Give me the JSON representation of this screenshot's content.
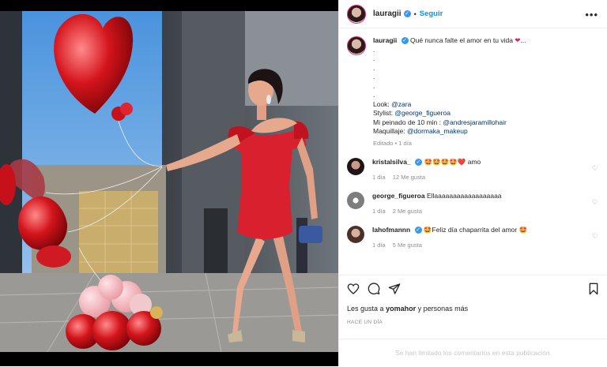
{
  "header": {
    "username": "lauragii",
    "follow_label": "Seguir",
    "more_label": "•••"
  },
  "caption": {
    "username": "lauragii",
    "text": "Qué nunca falte el amor en tu vida",
    "dots": [
      ".",
      ".",
      ".",
      ".",
      ".",
      "."
    ],
    "look_label": "Look:",
    "look_mention": "@zara",
    "stylist_label": "Stylist:",
    "stylist_mention": "@george_figueroa",
    "hair_label": "Mi peinado de 10 min :",
    "hair_mention": "@andresjaramillohair",
    "makeup_label": "Maquillaje:",
    "makeup_mention": "@dormaka_makeup",
    "edited": "Editado",
    "sep": "•",
    "time": "1 día"
  },
  "comments": [
    {
      "username": "kristalsilva_",
      "text": "amo",
      "emojis": "🤩🤩🤩🤩❤️",
      "time": "1 día",
      "likes": "12 Me gusta",
      "verified": true
    },
    {
      "username": "george_figueroa",
      "text": "Ellaaaaaaaaaaaaaaaaaa",
      "emojis": "",
      "time": "1 día",
      "likes": "2 Me gusta",
      "verified": false
    },
    {
      "username": "lahofmannn",
      "text": "Feliz día chaparrita del amor",
      "emojis": "🤩",
      "emoji_after": "🤩",
      "time": "1 día",
      "likes": "5 Me gusta",
      "verified": true
    }
  ],
  "footer": {
    "likes_prefix": "Les gusta a",
    "likes_user": "yomahor",
    "likes_suffix": "y personas más",
    "ago": "HACE UN DÍA",
    "limited": "Se han limitado los comentarios en esta publicación."
  },
  "colors": {
    "accent": "#0095f6",
    "dress": "#d8202e",
    "sky": "#78aee6"
  }
}
